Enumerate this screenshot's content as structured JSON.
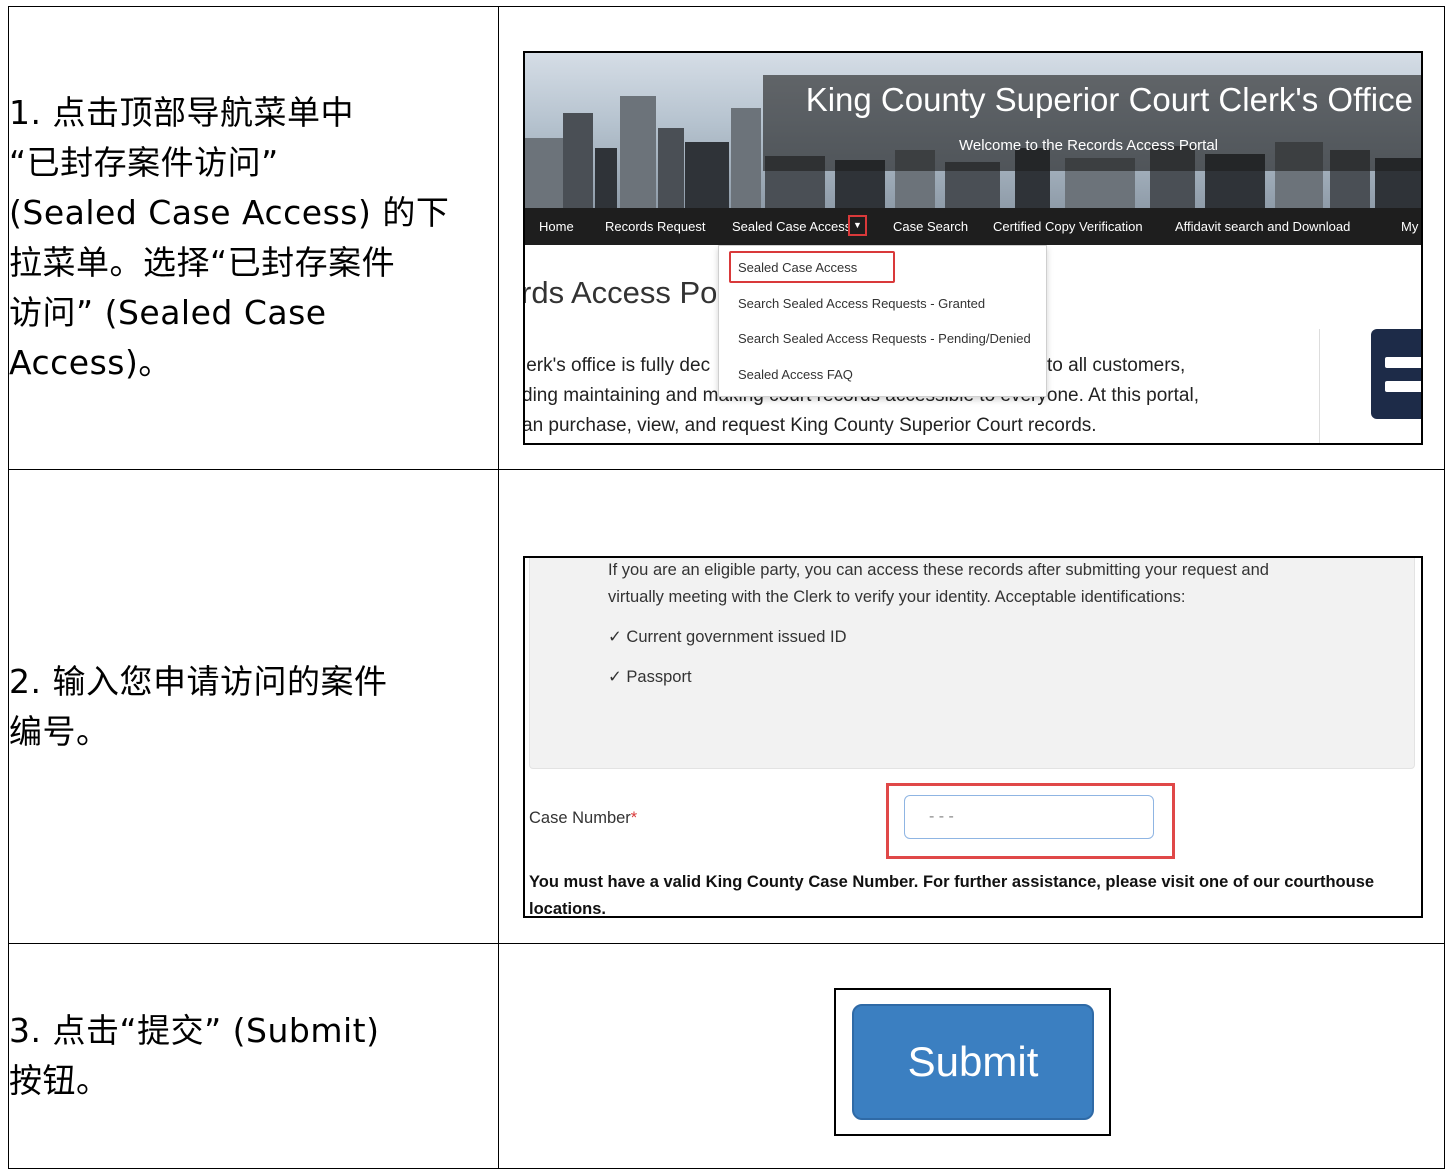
{
  "steps": [
    {
      "instruction_lines": [
        "1. 点击顶部导航菜单中",
        "“已封存案件访问”",
        "(Sealed Case Access) 的下",
        "拉菜单。选择“已封存案件",
        "访问” (Sealed Case",
        "Access)。"
      ],
      "screenshot": {
        "banner_title": "King County Superior Court Clerk's Office",
        "banner_subtitle": "Welcome to the Records Access Portal",
        "nav": {
          "home": "Home",
          "records_request": "Records Request",
          "sealed_case_access": "Sealed Case Access",
          "case_search": "Case Search",
          "certified_copy_verification": "Certified Copy Verification",
          "affidavit_search": "Affidavit search and Download",
          "my": "My"
        },
        "dropdown_items": [
          "Sealed Case Access",
          "Search Sealed Access Requests - Granted",
          "Search Sealed Access Requests - Pending/Denied",
          "Sealed Access FAQ"
        ],
        "page_heading": "rds Access Por",
        "page_lines": [
          "lerk's office is fully dec",
          "to all customers,",
          "ding maintaining and making court records accessible to everyone. At this portal,",
          "an purchase, view, and request King County Superior Court records."
        ]
      }
    },
    {
      "instruction_lines": [
        "2. 输入您申请访问的案件",
        "编号。"
      ],
      "screenshot": {
        "intro_line_1": "If you are an eligible party, you can access these records after submitting your request and",
        "intro_line_2": "virtually meeting with the Clerk to verify your identity. Acceptable identifications:",
        "id_options": [
          "✓ Current government issued ID",
          "✓ Passport"
        ],
        "case_number_label": "Case Number",
        "required_marker": "*",
        "case_number_value": "- -   -",
        "help_text": "You must have a valid King County Case Number. For further assistance, please visit one of our courthouse locations."
      }
    },
    {
      "instruction_lines": [
        "3. 点击“提交” (Submit)",
        "按钮。"
      ],
      "screenshot": {
        "submit_label": "Submit"
      }
    }
  ],
  "colors": {
    "highlight_red": "#d9393a",
    "nav_background": "#1e1e1e",
    "submit_blue": "#3b7fc1"
  }
}
